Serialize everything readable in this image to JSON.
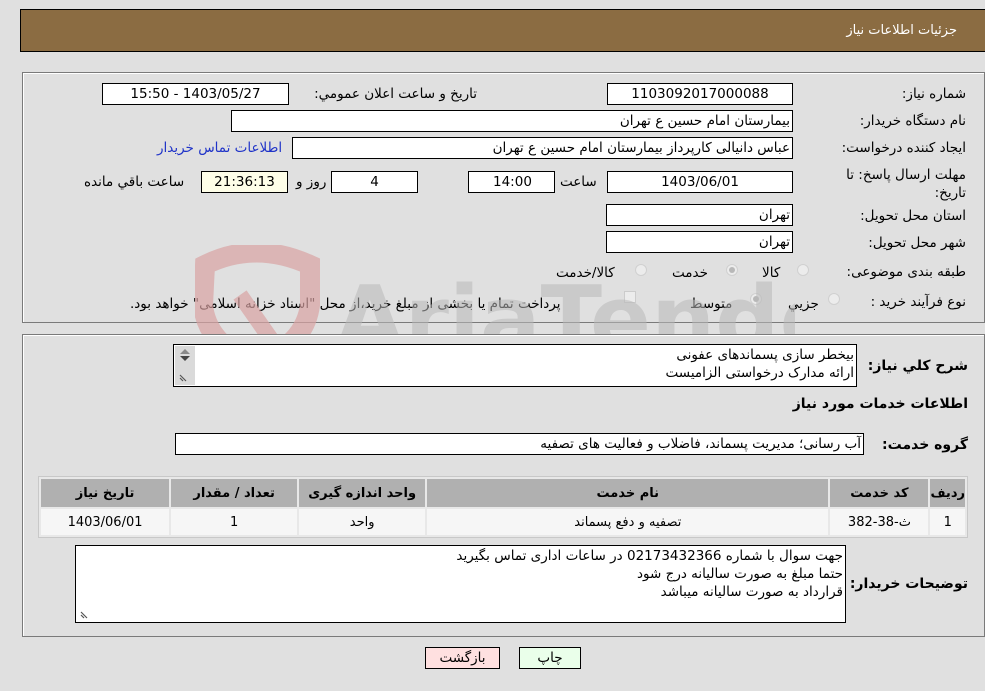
{
  "header": {
    "title": "جزئیات اطلاعات نیاز"
  },
  "form": {
    "need_number": {
      "label": "شماره نیاز:",
      "value": "1103092017000088"
    },
    "announce_datetime": {
      "label": "تاریخ و ساعت اعلان عمومي:",
      "value": "1403/05/27 - 15:50"
    },
    "buyer_org": {
      "label": "نام دستگاه خريدار:",
      "value": "بیمارستان امام حسین  ع  تهران"
    },
    "requester": {
      "label": "ايجاد کننده درخواست:",
      "value": "عباس دانیالی کارپرداز بیمارستان امام حسین  ع  تهران"
    },
    "buyer_contact_link": "اطلاعات تماس خريدار",
    "deadline": {
      "label": "مهلت ارسال پاسخ: تا تاریخ:",
      "date": "1403/06/01",
      "time_label": "ساعت",
      "time": "14:00",
      "days": "4",
      "days_label": "روز و",
      "remaining": "21:36:13",
      "remaining_label": "ساعت باقي مانده"
    },
    "province": {
      "label": "استان محل تحویل:",
      "value": "تهران"
    },
    "city": {
      "label": "شهر محل تحویل:",
      "value": "تهران"
    },
    "category": {
      "label": "طبقه بندی موضوعی:",
      "options": [
        "کالا",
        "خدمت",
        "کالا/خدمت"
      ],
      "selected": "خدمت"
    },
    "purchase_type": {
      "label": "نوع فرآيند خريد :",
      "options": [
        "جزيي",
        "متوسط"
      ],
      "selected": "متوسط",
      "treasury_checkbox_label": "پرداخت تمام يا بخشی از مبلغ خريد،از محل \"اسناد خزانه اسلامی\" خواهد بود.",
      "treasury_checked": false
    }
  },
  "description": {
    "label": "شرح كلي نياز:",
    "lines": [
      "بیخطر سازی پسماندهای عفونی",
      "ارائه مدارک درخواستی الزامیست"
    ]
  },
  "services_section": {
    "title": "اطلاعات خدمات مورد نياز",
    "group_label": "گروه خدمت:",
    "group_value": "آب رسانی؛ مدیریت پسماند، فاضلاب و فعالیت های تصفیه"
  },
  "table": {
    "headers": [
      "رديف",
      "کد خدمت",
      "نام خدمت",
      "واحد اندازه گيری",
      "تعداد / مقدار",
      "تاریخ نیاز"
    ],
    "rows": [
      [
        "1",
        "ث-38-382",
        "تصفیه و دفع پسماند",
        "واحد",
        "1",
        "1403/06/01"
      ]
    ]
  },
  "buyer_notes": {
    "label": "توضيحات خريدار:",
    "lines": [
      "جهت سوال با شماره 02173432366 در ساعات اداری تماس بگیرید",
      "حتما مبلغ به صورت سالیانه درج شود",
      "قرارداد به صورت سالیانه میباشد"
    ]
  },
  "buttons": {
    "print": "چاپ",
    "back": "بازگشت"
  },
  "colors": {
    "header_bg": "#8b6c42",
    "back_btn": "#ffe0e0",
    "print_btn": "#eaffea",
    "link": "#1f33c8"
  }
}
